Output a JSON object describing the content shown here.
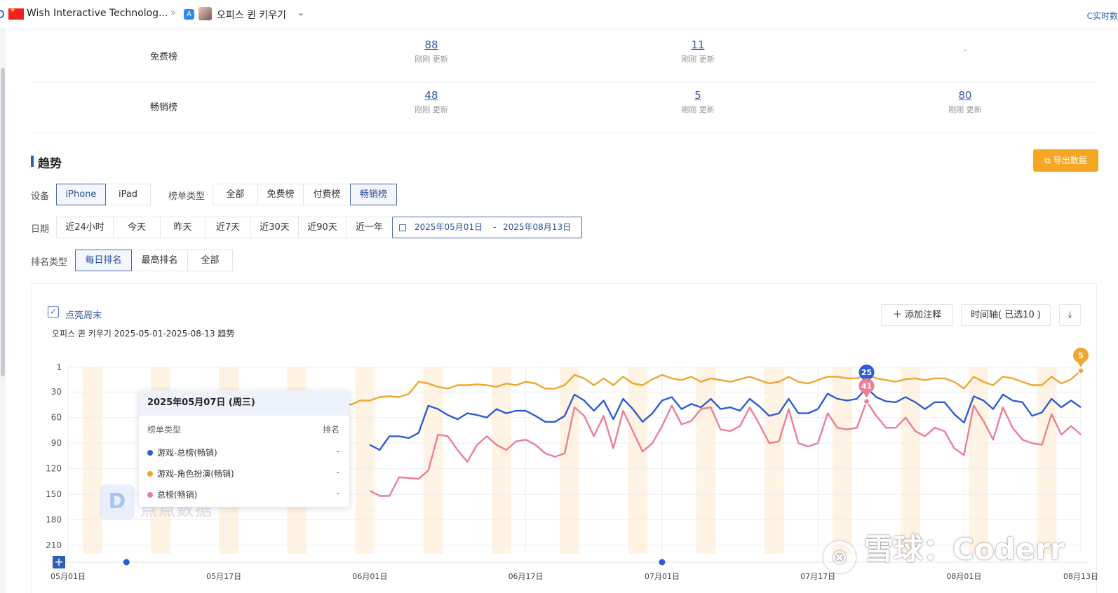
{
  "topbar": {
    "company": "Wish Interactive Technolog...",
    "separator": "»",
    "app_name": "오피스 퀸 키우기",
    "realtime_label": "C实时数"
  },
  "rank_table": {
    "rows": [
      {
        "label": "免费榜",
        "cells": [
          {
            "value": "88",
            "updated": "刚刚 更新"
          },
          {
            "value": "11",
            "updated": "刚刚 更新"
          },
          {
            "value": "-",
            "updated": ""
          }
        ]
      },
      {
        "label": "畅销榜",
        "cells": [
          {
            "value": "48",
            "updated": "刚刚 更新"
          },
          {
            "value": "5",
            "updated": "刚刚 更新"
          },
          {
            "value": "80",
            "updated": "刚刚 更新"
          }
        ]
      }
    ]
  },
  "trend": {
    "title": "趋势",
    "export_label": "导出数据",
    "device_label": "设备",
    "devices": [
      "iPhone",
      "iPad"
    ],
    "device_selected": "iPhone",
    "list_type_label": "榜单类型",
    "list_types": [
      "全部",
      "免费榜",
      "付费榜",
      "畅销榜"
    ],
    "list_type_selected": "畅销榜",
    "date_label": "日期",
    "date_options": [
      "近24小时",
      "今天",
      "昨天",
      "近7天",
      "近30天",
      "近90天",
      "近一年"
    ],
    "date_start": "2025年05月01日",
    "date_sep": "-",
    "date_end": "2025年08月13日",
    "rank_type_label": "排名类型",
    "rank_types": [
      "每日排名",
      "最高排名",
      "全部"
    ],
    "rank_type_selected": "每日排名"
  },
  "chart_panel": {
    "weekend_label": "点亮周末",
    "subtitle": "오피스 퀸 키우기 2025-05-01-2025-08-13 趋势",
    "add_note_label": "添加注释",
    "timeline_label": "时间轴( 已选10 )",
    "tooltip": {
      "title": "2025年05月07日 (周三)",
      "col1": "榜单类型",
      "col2": "排名",
      "rows": [
        {
          "name": "游戏-总榜(畅销)",
          "value": "-",
          "color": "#2f5bd3"
        },
        {
          "name": "游戏-角色扮演(畅销)",
          "value": "-",
          "color": "#f0a630"
        },
        {
          "name": "总榜(畅销)",
          "value": "-",
          "color": "#ec7e95"
        }
      ]
    },
    "watermark_text": "点点数据",
    "brand_watermark": "雪球：Coderr"
  },
  "chart_data": {
    "type": "line",
    "title": "오피스 퀸 키우기 2025-05-01-2025-08-13 趋势",
    "y_inverted": true,
    "ylim": [
      1,
      210
    ],
    "y_ticks": [
      1,
      30,
      60,
      90,
      120,
      150,
      180,
      210
    ],
    "x_tick_labels": [
      "05月01日",
      "05月17日",
      "06月01日",
      "06月17日",
      "07月01日",
      "07月17日",
      "08月01日",
      "08月13日"
    ],
    "x_tick_days": [
      0,
      16,
      31,
      47,
      61,
      77,
      92,
      104
    ],
    "weekend_highlight": true,
    "series": [
      {
        "name": "游戏-总榜(畅销)",
        "color": "#2f5bd3",
        "points": [
          [
            31,
            92
          ],
          [
            32,
            98
          ],
          [
            33,
            82
          ],
          [
            34,
            82
          ],
          [
            35,
            84
          ],
          [
            36,
            78
          ],
          [
            37,
            46
          ],
          [
            38,
            50
          ],
          [
            39,
            57
          ],
          [
            40,
            62
          ],
          [
            41,
            55
          ],
          [
            42,
            57
          ],
          [
            43,
            60
          ],
          [
            44,
            50
          ],
          [
            45,
            55
          ],
          [
            46,
            52
          ],
          [
            47,
            52
          ],
          [
            48,
            58
          ],
          [
            49,
            65
          ],
          [
            50,
            65
          ],
          [
            51,
            58
          ],
          [
            52,
            33
          ],
          [
            53,
            40
          ],
          [
            54,
            52
          ],
          [
            55,
            40
          ],
          [
            56,
            62
          ],
          [
            57,
            38
          ],
          [
            58,
            50
          ],
          [
            59,
            65
          ],
          [
            60,
            55
          ],
          [
            61,
            40
          ],
          [
            62,
            36
          ],
          [
            63,
            50
          ],
          [
            64,
            44
          ],
          [
            65,
            48
          ],
          [
            66,
            38
          ],
          [
            67,
            50
          ],
          [
            68,
            48
          ],
          [
            69,
            52
          ],
          [
            70,
            38
          ],
          [
            71,
            47
          ],
          [
            72,
            58
          ],
          [
            73,
            55
          ],
          [
            74,
            38
          ],
          [
            75,
            55
          ],
          [
            76,
            55
          ],
          [
            77,
            50
          ],
          [
            78,
            32
          ],
          [
            79,
            38
          ],
          [
            80,
            40
          ],
          [
            81,
            38
          ],
          [
            82,
            25
          ],
          [
            83,
            36
          ],
          [
            84,
            41
          ],
          [
            85,
            42
          ],
          [
            86,
            36
          ],
          [
            87,
            42
          ],
          [
            88,
            50
          ],
          [
            89,
            42
          ],
          [
            90,
            42
          ],
          [
            91,
            56
          ],
          [
            92,
            66
          ],
          [
            93,
            35
          ],
          [
            94,
            40
          ],
          [
            95,
            50
          ],
          [
            96,
            33
          ],
          [
            97,
            40
          ],
          [
            98,
            42
          ],
          [
            99,
            58
          ],
          [
            100,
            54
          ],
          [
            101,
            38
          ],
          [
            102,
            48
          ],
          [
            103,
            40
          ],
          [
            104,
            48
          ]
        ]
      },
      {
        "name": "游戏-角色扮演(畅销)",
        "color": "#f0a630",
        "points": [
          [
            28,
            38
          ],
          [
            29,
            45
          ],
          [
            30,
            40
          ],
          [
            31,
            40
          ],
          [
            32,
            36
          ],
          [
            33,
            35
          ],
          [
            34,
            36
          ],
          [
            35,
            32
          ],
          [
            36,
            18
          ],
          [
            37,
            20
          ],
          [
            38,
            24
          ],
          [
            39,
            26
          ],
          [
            40,
            22
          ],
          [
            41,
            22
          ],
          [
            42,
            21
          ],
          [
            43,
            22
          ],
          [
            44,
            24
          ],
          [
            45,
            20
          ],
          [
            46,
            22
          ],
          [
            47,
            18
          ],
          [
            48,
            20
          ],
          [
            49,
            26
          ],
          [
            50,
            26
          ],
          [
            51,
            22
          ],
          [
            52,
            10
          ],
          [
            53,
            14
          ],
          [
            54,
            22
          ],
          [
            55,
            14
          ],
          [
            56,
            22
          ],
          [
            57,
            12
          ],
          [
            58,
            20
          ],
          [
            59,
            22
          ],
          [
            60,
            15
          ],
          [
            61,
            10
          ],
          [
            62,
            14
          ],
          [
            63,
            16
          ],
          [
            64,
            12
          ],
          [
            65,
            18
          ],
          [
            66,
            14
          ],
          [
            67,
            16
          ],
          [
            68,
            18
          ],
          [
            69,
            15
          ],
          [
            70,
            12
          ],
          [
            71,
            16
          ],
          [
            72,
            20
          ],
          [
            73,
            18
          ],
          [
            74,
            12
          ],
          [
            75,
            18
          ],
          [
            76,
            20
          ],
          [
            77,
            16
          ],
          [
            78,
            12
          ],
          [
            79,
            12
          ],
          [
            80,
            14
          ],
          [
            81,
            14
          ],
          [
            82,
            10
          ],
          [
            83,
            14
          ],
          [
            84,
            16
          ],
          [
            85,
            18
          ],
          [
            86,
            15
          ],
          [
            87,
            14
          ],
          [
            88,
            16
          ],
          [
            89,
            14
          ],
          [
            90,
            14
          ],
          [
            91,
            18
          ],
          [
            92,
            26
          ],
          [
            93,
            12
          ],
          [
            94,
            18
          ],
          [
            95,
            22
          ],
          [
            96,
            12
          ],
          [
            97,
            14
          ],
          [
            98,
            18
          ],
          [
            99,
            22
          ],
          [
            100,
            22
          ],
          [
            101,
            12
          ],
          [
            102,
            20
          ],
          [
            103,
            15
          ],
          [
            104,
            5
          ]
        ]
      },
      {
        "name": "总榜(畅销)",
        "color": "#ec7e95",
        "points": [
          [
            31,
            146
          ],
          [
            32,
            152
          ],
          [
            33,
            152
          ],
          [
            34,
            130
          ],
          [
            35,
            131
          ],
          [
            36,
            132
          ],
          [
            37,
            122
          ],
          [
            38,
            80
          ],
          [
            39,
            82
          ],
          [
            40,
            98
          ],
          [
            41,
            112
          ],
          [
            42,
            92
          ],
          [
            43,
            82
          ],
          [
            44,
            92
          ],
          [
            45,
            98
          ],
          [
            46,
            88
          ],
          [
            47,
            86
          ],
          [
            48,
            92
          ],
          [
            49,
            102
          ],
          [
            50,
            106
          ],
          [
            51,
            102
          ],
          [
            52,
            48
          ],
          [
            53,
            58
          ],
          [
            54,
            82
          ],
          [
            55,
            58
          ],
          [
            56,
            96
          ],
          [
            57,
            52
          ],
          [
            58,
            76
          ],
          [
            59,
            100
          ],
          [
            60,
            90
          ],
          [
            61,
            70
          ],
          [
            62,
            46
          ],
          [
            63,
            68
          ],
          [
            64,
            64
          ],
          [
            65,
            50
          ],
          [
            66,
            48
          ],
          [
            67,
            74
          ],
          [
            68,
            76
          ],
          [
            69,
            70
          ],
          [
            70,
            48
          ],
          [
            71,
            68
          ],
          [
            72,
            90
          ],
          [
            73,
            88
          ],
          [
            74,
            50
          ],
          [
            75,
            90
          ],
          [
            76,
            94
          ],
          [
            77,
            90
          ],
          [
            78,
            55
          ],
          [
            79,
            72
          ],
          [
            80,
            74
          ],
          [
            81,
            72
          ],
          [
            82,
            41
          ],
          [
            83,
            58
          ],
          [
            84,
            72
          ],
          [
            85,
            72
          ],
          [
            86,
            60
          ],
          [
            87,
            76
          ],
          [
            88,
            82
          ],
          [
            89,
            72
          ],
          [
            90,
            76
          ],
          [
            91,
            96
          ],
          [
            92,
            104
          ],
          [
            93,
            46
          ],
          [
            94,
            64
          ],
          [
            95,
            86
          ],
          [
            96,
            48
          ],
          [
            97,
            72
          ],
          [
            98,
            86
          ],
          [
            99,
            90
          ],
          [
            100,
            92
          ],
          [
            101,
            56
          ],
          [
            102,
            80
          ],
          [
            103,
            70
          ],
          [
            104,
            80
          ]
        ]
      }
    ],
    "markers": [
      {
        "series": 0,
        "day": 82,
        "value": 25,
        "label": "25",
        "color": "#2f5bd3"
      },
      {
        "series": 2,
        "day": 82,
        "value": 41,
        "label": "41",
        "color": "#ec7e95"
      },
      {
        "series": 1,
        "day": 104,
        "value": 5,
        "label": "5",
        "color": "#f0a630"
      }
    ],
    "timeline_dots": [
      6,
      61
    ]
  }
}
